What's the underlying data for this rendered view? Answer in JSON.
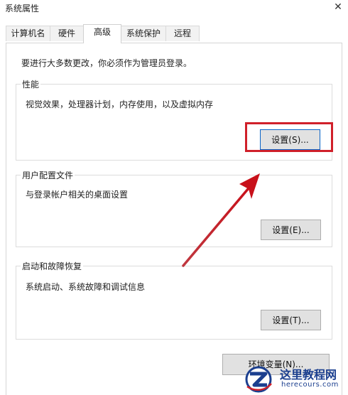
{
  "window": {
    "title": "系统属性",
    "close_glyph": "✕"
  },
  "tabs": [
    {
      "label": "计算机名"
    },
    {
      "label": "硬件"
    },
    {
      "label": "高级"
    },
    {
      "label": "系统保护"
    },
    {
      "label": "远程"
    }
  ],
  "active_tab": "高级",
  "admin_note": "要进行大多数更改，你必须作为管理员登录。",
  "groups": {
    "performance": {
      "legend": "性能",
      "description": "视觉效果，处理器计划，内存使用，以及虚拟内存",
      "button": "设置(S)..."
    },
    "user_profiles": {
      "legend": "用户配置文件",
      "description": "与登录帐户相关的桌面设置",
      "button": "设置(E)..."
    },
    "startup_recovery": {
      "legend": "启动和故障恢复",
      "description": "系统启动、系统故障和调试信息",
      "button": "设置(T)..."
    }
  },
  "env_button": "环境变量(N)...",
  "watermark": {
    "site_name": "这里教程网",
    "url": "herecours.com"
  },
  "colors": {
    "highlight": "#d0202a",
    "accent": "#0a64c8",
    "watermark": "#1b3f8f"
  }
}
